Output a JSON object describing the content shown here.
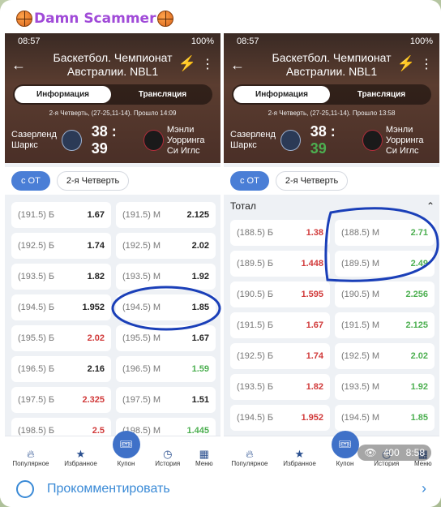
{
  "channel": {
    "name": "Damn Scammer"
  },
  "status": {
    "time": "08:57",
    "battery": "100%"
  },
  "match": {
    "title_line1": "Баскетбол. Чемпионат",
    "title_line2": "Австралии. NBL1",
    "tab_info": "Информация",
    "tab_stream": "Трансляция",
    "home": "Сазерленд Шаркс",
    "away": "Мэнли Уорринга Си Иглс",
    "score_home": "38",
    "score_away": "39",
    "period_left": "2-я Четверть, (27-25,11-14). Прошло 14:09",
    "period_right": "2-я Четверть, (27-25,11-14). Прошло 13:58"
  },
  "filters": {
    "chip1": "с ОТ",
    "chip2": "2-я Четверть"
  },
  "left_rows": [
    {
      "l": "(191.5) Б",
      "lv": "1.67",
      "lc": "",
      "r": "(191.5) М",
      "rv": "2.125",
      "rc": ""
    },
    {
      "l": "(192.5) Б",
      "lv": "1.74",
      "lc": "",
      "r": "(192.5) М",
      "rv": "2.02",
      "rc": ""
    },
    {
      "l": "(193.5) Б",
      "lv": "1.82",
      "lc": "",
      "r": "(193.5) М",
      "rv": "1.92",
      "rc": ""
    },
    {
      "l": "(194.5) Б",
      "lv": "1.952",
      "lc": "",
      "r": "(194.5) М",
      "rv": "1.85",
      "rc": ""
    },
    {
      "l": "(195.5) Б",
      "lv": "2.02",
      "lc": "red",
      "r": "(195.5) М",
      "rv": "1.67",
      "rc": ""
    },
    {
      "l": "(196.5) Б",
      "lv": "2.16",
      "lc": "",
      "r": "(196.5) М",
      "rv": "1.59",
      "rc": "grn"
    },
    {
      "l": "(197.5) Б",
      "lv": "2.325",
      "lc": "red",
      "r": "(197.5) М",
      "rv": "1.51",
      "rc": ""
    },
    {
      "l": "(198.5) Б",
      "lv": "2.5",
      "lc": "red",
      "r": "(198.5) М",
      "rv": "1.445",
      "rc": "grn"
    }
  ],
  "right_total": "Тотал",
  "right_rows": [
    {
      "l": "(188.5) Б",
      "lv": "1.38",
      "lc": "red",
      "r": "(188.5) М",
      "rv": "2.71",
      "rc": "grn"
    },
    {
      "l": "(189.5) Б",
      "lv": "1.448",
      "lc": "red",
      "r": "(189.5) М",
      "rv": "2.49",
      "rc": "grn"
    },
    {
      "l": "(190.5) Б",
      "lv": "1.595",
      "lc": "red",
      "r": "(190.5) М",
      "rv": "2.256",
      "rc": "grn"
    },
    {
      "l": "(191.5) Б",
      "lv": "1.67",
      "lc": "red",
      "r": "(191.5) М",
      "rv": "2.125",
      "rc": "grn"
    },
    {
      "l": "(192.5) Б",
      "lv": "1.74",
      "lc": "red",
      "r": "(192.5) М",
      "rv": "2.02",
      "rc": "grn"
    },
    {
      "l": "(193.5) Б",
      "lv": "1.82",
      "lc": "red",
      "r": "(193.5) М",
      "rv": "1.92",
      "rc": "grn"
    },
    {
      "l": "(194.5) Б",
      "lv": "1.952",
      "lc": "red",
      "r": "(194.5) М",
      "rv": "1.85",
      "rc": "grn"
    }
  ],
  "tabs": {
    "popular": "Популярное",
    "fav": "Избранное",
    "coupon": "Купон",
    "history": "История",
    "menu": "Меню"
  },
  "post": {
    "views": "400",
    "time": "8:58",
    "comment": "Прокомментировать"
  }
}
